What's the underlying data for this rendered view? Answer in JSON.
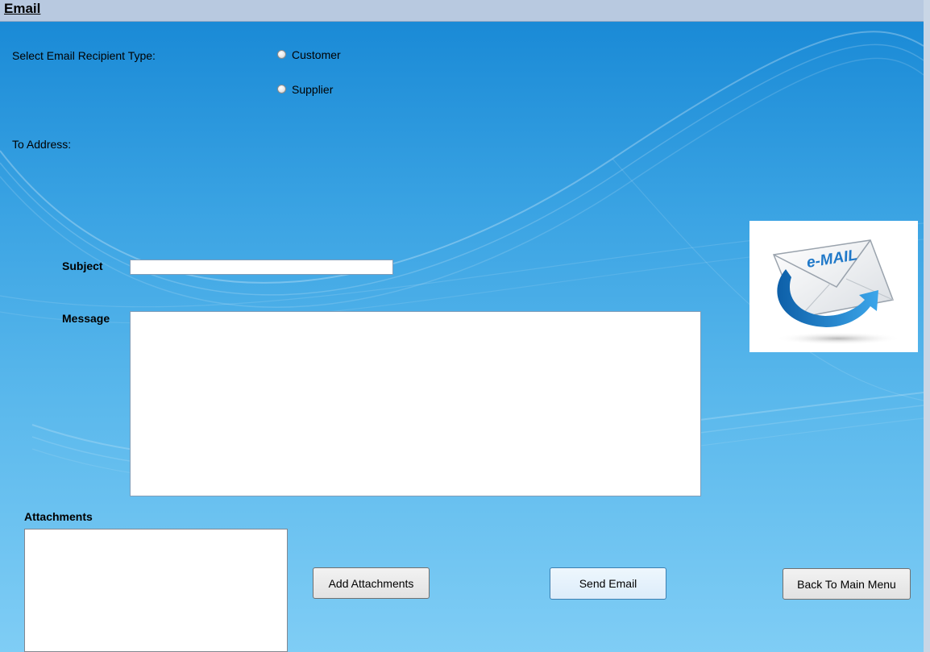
{
  "window": {
    "title": "Email"
  },
  "recipient": {
    "label": "Select Email Recipient Type:",
    "options": [
      "Customer",
      "Supplier"
    ]
  },
  "to_address": {
    "label": "To Address:"
  },
  "subject": {
    "label": "Subject",
    "value": ""
  },
  "message": {
    "label": "Message",
    "value": ""
  },
  "attachments": {
    "label": "Attachments"
  },
  "buttons": {
    "add_attachments": "Add Attachments",
    "send_email": "Send Email",
    "back_to_main": "Back To Main Menu"
  },
  "logo": {
    "text": "e-MAIL"
  }
}
